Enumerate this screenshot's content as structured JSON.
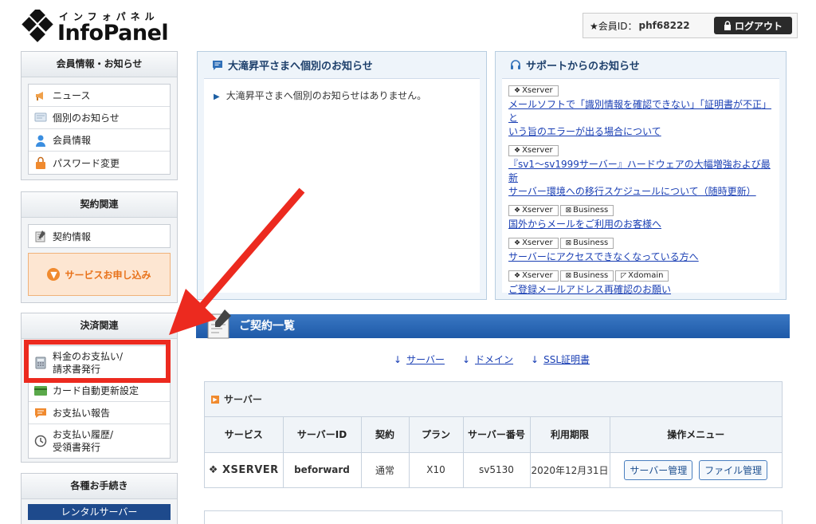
{
  "header": {
    "logo_kana": "インフォパネル",
    "logo_text": "InfoPanel",
    "member_id_label": "★会員ID：",
    "member_id": "phf68222",
    "logout_label": "ログアウト"
  },
  "sidebar": {
    "member": {
      "title": "会員情報・お知らせ",
      "items": [
        {
          "label": "ニュース",
          "icon": "megaphone-icon"
        },
        {
          "label": "個別のお知らせ",
          "icon": "message-icon"
        },
        {
          "label": "会員情報",
          "icon": "user-icon"
        },
        {
          "label": "パスワード変更",
          "icon": "lock-icon"
        }
      ]
    },
    "contract": {
      "title": "契約関連",
      "items": [
        {
          "label": "契約情報",
          "icon": "document-icon"
        }
      ],
      "apply_label": "サービスお申し込み"
    },
    "payment": {
      "title": "決済関連",
      "items": [
        {
          "label": "料金のお支払い/",
          "label2": "請求書発行",
          "icon": "calculator-icon"
        },
        {
          "label": "カード自動更新設定",
          "icon": "card-icon"
        },
        {
          "label": "お支払い報告",
          "icon": "chat-icon"
        },
        {
          "label": "お支払い履歴/",
          "label2": "受領書発行",
          "icon": "clock-icon"
        }
      ]
    },
    "procedures": {
      "title": "各種お手続き",
      "rental_label": "レンタルサーバー"
    }
  },
  "notice_panel": {
    "title": "大滝昇平さまへ個別のお知らせ",
    "message": "大滝昇平さまへ個別のお知らせはありません。"
  },
  "support_panel": {
    "title": "サポートからのお知らせ",
    "items": [
      {
        "tags": [
          "Xserver"
        ],
        "lines": [
          "メールソフトで「識別情報を確認できない」「証明書が不正」と",
          "いう旨のエラーが出る場合について"
        ]
      },
      {
        "tags": [
          "Xserver"
        ],
        "lines": [
          "『sv1～sv1999サーバー』ハードウェアの大幅増強および最新",
          "サーバー環境への移行スケジュールについて（随時更新）"
        ]
      },
      {
        "tags": [
          "Xserver",
          "Business"
        ],
        "lines": [
          "国外からメールをご利用のお客様へ"
        ]
      },
      {
        "tags": [
          "Xserver",
          "Business"
        ],
        "lines": [
          "サーバーにアクセスできなくなっている方へ"
        ]
      },
      {
        "tags": [
          "Xserver",
          "Business",
          "Xdomain"
        ],
        "lines": [
          "ご登録メールアドレス再確認のお願い"
        ]
      }
    ]
  },
  "contracts": {
    "title": "ご契約一覧",
    "anchors": [
      "サーバー",
      "ドメイン",
      "SSL証明書"
    ],
    "server_section_title": "サーバー",
    "columns": [
      "サービス",
      "サーバーID",
      "契約",
      "プラン",
      "サーバー番号",
      "利用期限",
      "操作メニュー"
    ],
    "rows": [
      {
        "service": "XSERVER",
        "server_id": "beforward",
        "contract": "通常",
        "plan": "X10",
        "server_no": "sv5130",
        "expiry": "2020年12月31日",
        "btn1": "サーバー管理",
        "btn2": "ファイル管理"
      }
    ]
  },
  "colors": {
    "accent": "#1e5aa8",
    "highlight": "#ec2a1f",
    "apply": "#e8721a"
  }
}
